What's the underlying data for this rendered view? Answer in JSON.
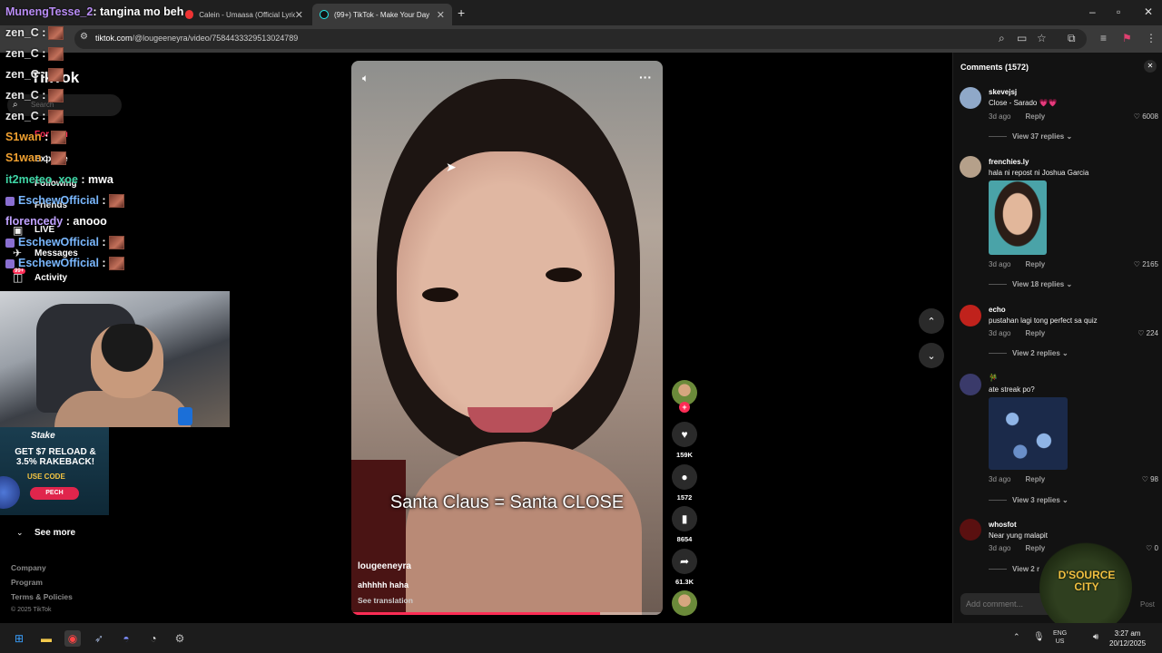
{
  "browser": {
    "tabs": [
      {
        "label": "Calein - Umaasa (Official Lyric V",
        "active": false
      },
      {
        "label": "(99+) TikTok - Make Your Day",
        "active": true
      }
    ],
    "url_host": "tiktok.com",
    "url_path": "/@lougeeneyra/video/7584433329513024789"
  },
  "stream_chat": [
    {
      "user": "MunengTesse_2",
      "message": ": tangina mo beh",
      "color": "#b98cf5",
      "emote": false
    },
    {
      "user": "zen_C",
      "message": " :",
      "color": "#e6e6e6",
      "emote": true
    },
    {
      "user": "zen_C",
      "message": " :",
      "color": "#e6e6e6",
      "emote": true
    },
    {
      "user": "zen_C",
      "message": " :",
      "color": "#e6e6e6",
      "emote": true
    },
    {
      "user": "zen_C",
      "message": " :",
      "color": "#e6e6e6",
      "emote": true
    },
    {
      "user": "zen_C",
      "message": " :",
      "color": "#e6e6e6",
      "emote": true
    },
    {
      "user": "S1wan",
      "message": " :",
      "color": "#f0a030",
      "emote": true
    },
    {
      "user": "S1wan",
      "message": " :",
      "color": "#f0a030",
      "emote": true
    },
    {
      "user": "it2meteo_xoe",
      "message": " : mwa",
      "color": "#3fd6a6",
      "emote": false
    },
    {
      "user": "EschewOfficial",
      "message": " :",
      "color": "#7ab8ff",
      "emote": true
    },
    {
      "user": "florencedy",
      "message": " : anooo",
      "color": "#c0a2ff",
      "emote": false
    },
    {
      "user": "EschewOfficial",
      "message": " :",
      "color": "#7ab8ff",
      "emote": true
    },
    {
      "user": "EschewOfficial",
      "message": " :",
      "color": "#7ab8ff",
      "emote": true
    }
  ],
  "tiktok_sidebar": {
    "logo": "TikTok",
    "search_placeholder": "Search",
    "items": [
      "For You",
      "Explore",
      "Following",
      "Friends",
      "LIVE",
      "Messages",
      "Activity"
    ],
    "activity_badge": "99+",
    "see_more": "See more",
    "footer": [
      "Company",
      "Program",
      "Terms & Policies"
    ],
    "copyright": "© 2025 TikTok"
  },
  "stake_ad": {
    "brand": "Stake",
    "headline": "GET $7 RELOAD & 3.5% RAKEBACK!",
    "code_label": "USE CODE",
    "code": "PECH"
  },
  "video": {
    "caption_overlay": "Santa Claus = Santa CLOSE",
    "author": "lougeeneyra",
    "description": "ahhhhh haha",
    "translate": "See translation",
    "progress": 0.8
  },
  "actions": {
    "likes": "159K",
    "comments": "1572",
    "saves": "8654",
    "shares": "61.3K"
  },
  "comments_panel": {
    "title": "Comments (1572)",
    "comments": [
      {
        "user": "skevejsj",
        "text": "Close - Sarado 💗💗",
        "time": "3d ago",
        "reply": "Reply",
        "likes": "6008",
        "replies": "View 37 replies",
        "avatar": "#8fa8c8"
      },
      {
        "user": "frenchies.ly",
        "text": "hala ni repost ni Joshua Garcia",
        "time": "3d ago",
        "reply": "Reply",
        "likes": "2165",
        "replies": "View 18 replies",
        "avatar": "#b5a08a"
      },
      {
        "user": "echo",
        "text": "pustahan lagi tong perfect sa quiz",
        "time": "3d ago",
        "reply": "Reply",
        "likes": "224",
        "replies": "View 2 replies",
        "avatar": "#c0221c"
      },
      {
        "user": "🎋",
        "text": "ate streak po?",
        "time": "3d ago",
        "reply": "Reply",
        "likes": "98",
        "replies": "View 3 replies",
        "avatar": "#3a3a6a"
      },
      {
        "user": "whosfot",
        "text": "Near yung malapit",
        "time": "3d ago",
        "reply": "Reply",
        "likes": "0",
        "replies": "View 2 r",
        "avatar": "#5a1010"
      }
    ],
    "add_comment": "Add comment...",
    "post": "Post"
  },
  "overlay_logo": "D'SOURCE CITY",
  "taskbar": {
    "lang": "ENG",
    "region": "US",
    "time": "3:27 am",
    "date": "20/12/2025"
  }
}
